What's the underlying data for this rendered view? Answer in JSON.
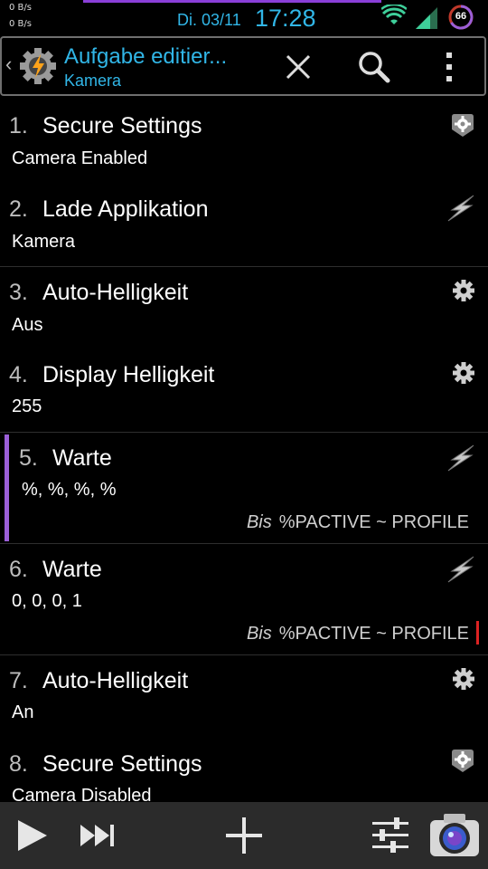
{
  "status": {
    "net_up": "0 B/s",
    "net_down": "0 B/s",
    "date": "Di. 03/11",
    "time": "17:28",
    "battery": "66"
  },
  "actionbar": {
    "title": "Aufgabe editier...",
    "subtitle": "Kamera"
  },
  "actions": [
    {
      "num": "1.",
      "title": "Secure Settings",
      "detail": "Camera Enabled",
      "icon": "plugin-gear-icon"
    },
    {
      "num": "2.",
      "title": "Lade Applikation",
      "detail": "Kamera",
      "icon": "bolt-icon"
    },
    {
      "num": "3.",
      "title": "Auto-Helligkeit",
      "detail": "Aus",
      "icon": "gear-icon"
    },
    {
      "num": "4.",
      "title": "Display Helligkeit",
      "detail": "255",
      "icon": "gear-icon"
    },
    {
      "num": "5.",
      "title": "Warte",
      "detail": "%,  %,  %,  %",
      "icon": "bolt-icon",
      "cond_label": "Bis",
      "cond_value": "%PACTIVE ~ PROFILE"
    },
    {
      "num": "6.",
      "title": "Warte",
      "detail": "0,  0,  0,  1",
      "icon": "bolt-icon",
      "cond_label": "Bis",
      "cond_value": "%PACTIVE ~ PROFILE"
    },
    {
      "num": "7.",
      "title": "Auto-Helligkeit",
      "detail": "An",
      "icon": "gear-icon"
    },
    {
      "num": "8.",
      "title": "Secure Settings",
      "detail": "Camera Disabled",
      "icon": "plugin-gear-icon"
    }
  ],
  "colors": {
    "accent": "#31b6e7",
    "selection_bar": "#9b5fd8",
    "error_bar": "#dd2222",
    "background": "#000000",
    "bottom_bar": "#2b2b2b"
  },
  "bottom_icons": [
    "play-icon",
    "skip-next-icon",
    "add-icon",
    "sliders-icon",
    "camera-icon"
  ]
}
